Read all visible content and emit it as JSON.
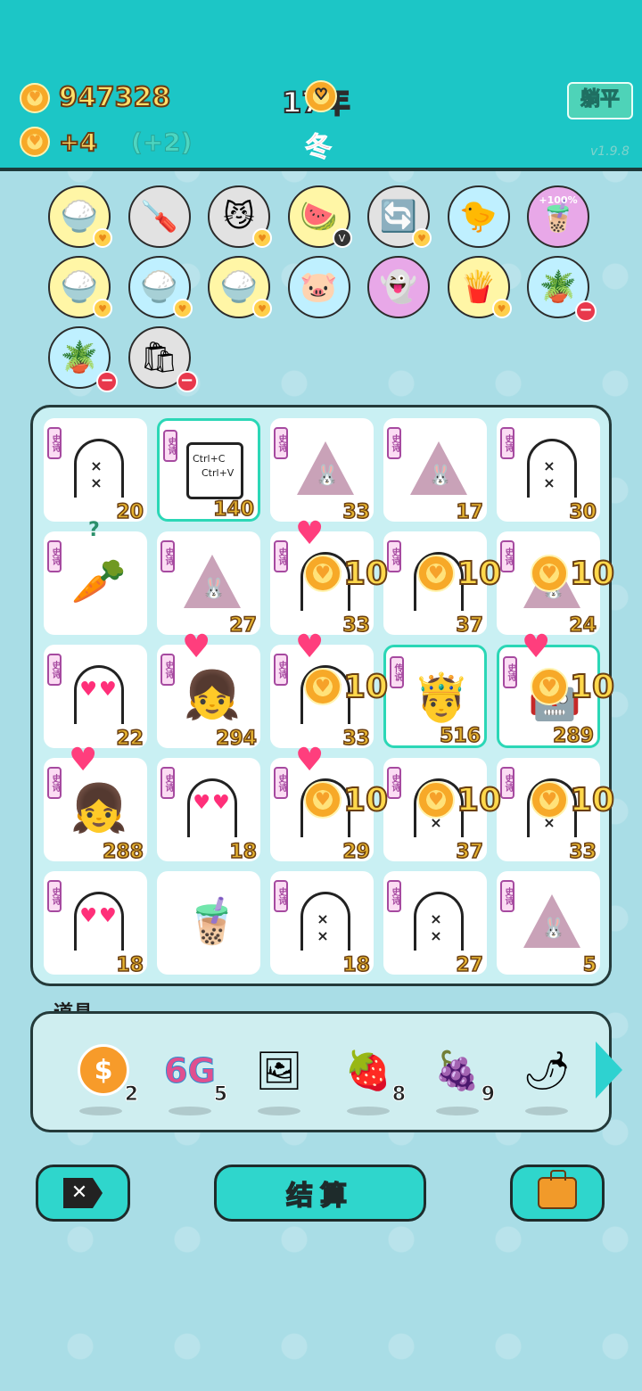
{
  "header": {
    "money": "947328",
    "income": "+4",
    "income_bonus": "(+2)",
    "year": "17年",
    "season": "冬",
    "flat_button": "躺平",
    "version": "v1.9.8"
  },
  "upgrades": [
    {
      "name": "rice-bowl",
      "color": "yellow",
      "glyph": "🍚",
      "marker": "coin"
    },
    {
      "name": "screwdriver",
      "color": "grey",
      "glyph": "🪛",
      "marker": ""
    },
    {
      "name": "glasses-cats",
      "color": "grey",
      "glyph": "😼",
      "marker": "coin"
    },
    {
      "name": "fruit-basket",
      "color": "yellow",
      "glyph": "🍉",
      "marker": "v"
    },
    {
      "name": "refresh",
      "color": "grey",
      "glyph": "🔄",
      "marker": "coin"
    },
    {
      "name": "chick",
      "color": "blue",
      "glyph": "🐤",
      "marker": ""
    },
    {
      "name": "milk-tea-plus",
      "color": "pink",
      "glyph": "🧋",
      "marker": "+100%"
    },
    {
      "name": "rice-bowl-2",
      "color": "yellow",
      "glyph": "🍚",
      "marker": "coin"
    },
    {
      "name": "rice-bowl-3",
      "color": "blue",
      "glyph": "🍚",
      "marker": "coin"
    },
    {
      "name": "rice-bowl-4",
      "color": "yellow",
      "glyph": "🍚",
      "marker": "coin"
    },
    {
      "name": "piggy-bank",
      "color": "blue",
      "glyph": "🐷",
      "marker": ""
    },
    {
      "name": "ghost-card",
      "color": "pink",
      "glyph": "👻",
      "marker": ""
    },
    {
      "name": "fries",
      "color": "yellow",
      "glyph": "🍟",
      "marker": "coin"
    },
    {
      "name": "potted-flower",
      "color": "blue",
      "glyph": "🪴",
      "marker": "minus"
    },
    {
      "name": "potted-flower-2",
      "color": "blue",
      "glyph": "🪴",
      "marker": "minus"
    },
    {
      "name": "seed-bag",
      "color": "grey",
      "glyph": "🛍",
      "marker": "minus"
    }
  ],
  "board": {
    "tag_label": "史诗",
    "tag_label_legend": "传说",
    "cells": [
      {
        "kind": "ghost",
        "eyes": "× ×",
        "value": "20",
        "tag": "史诗"
      },
      {
        "kind": "ctrl",
        "value": "140",
        "tag": "史诗",
        "selected": true,
        "line1": "Ctrl+C",
        "line2": "Ctrl+V"
      },
      {
        "kind": "bunny",
        "value": "33",
        "tag": "史诗"
      },
      {
        "kind": "bunny",
        "value": "17",
        "tag": "史诗"
      },
      {
        "kind": "ghost",
        "eyes": "× ×",
        "value": "30",
        "tag": "史诗"
      },
      {
        "kind": "carrot",
        "value": "",
        "tag": "史诗",
        "extra": "?"
      },
      {
        "kind": "bunny",
        "value": "27",
        "tag": "史诗"
      },
      {
        "kind": "ghost-love",
        "value": "33",
        "tag": "史诗",
        "bonus": "10",
        "heart": true
      },
      {
        "kind": "ghost",
        "eyes": "",
        "value": "37",
        "tag": "史诗",
        "bonus": "10"
      },
      {
        "kind": "bunny",
        "value": "24",
        "tag": "史诗",
        "bonus": "10"
      },
      {
        "kind": "ghost-love",
        "value": "22",
        "tag": "史诗"
      },
      {
        "kind": "girl",
        "value": "294",
        "tag": "史诗",
        "heart": true
      },
      {
        "kind": "ghost-love",
        "value": "33",
        "tag": "史诗",
        "bonus": "10",
        "heart": true
      },
      {
        "kind": "king",
        "value": "516",
        "tag": "传说",
        "selected": true
      },
      {
        "kind": "robot",
        "value": "289",
        "tag": "史诗",
        "selected": true,
        "bonus": "10",
        "heart": true
      },
      {
        "kind": "girl",
        "value": "288",
        "tag": "史诗",
        "heart": true
      },
      {
        "kind": "ghost-love",
        "value": "18",
        "tag": "史诗"
      },
      {
        "kind": "ghost-love",
        "value": "29",
        "tag": "史诗",
        "bonus": "10",
        "heart": true
      },
      {
        "kind": "ghost",
        "eyes": "× ×",
        "value": "37",
        "tag": "史诗",
        "bonus": "10"
      },
      {
        "kind": "ghost",
        "eyes": "× ×",
        "value": "33",
        "tag": "史诗",
        "bonus": "10"
      },
      {
        "kind": "ghost-love",
        "value": "18",
        "tag": "史诗"
      },
      {
        "kind": "milktea",
        "value": "",
        "tag": ""
      },
      {
        "kind": "ghost",
        "eyes": "× ×",
        "value": "18",
        "tag": "史诗"
      },
      {
        "kind": "ghost",
        "eyes": "× ×",
        "value": "27",
        "tag": "史诗"
      },
      {
        "kind": "bunny",
        "value": "5",
        "tag": "史诗"
      }
    ]
  },
  "items_panel": {
    "label": "道具",
    "items": [
      {
        "name": "coin-dollar",
        "glyph": "$",
        "count": "2"
      },
      {
        "name": "6g",
        "glyph": "6G",
        "count": "5"
      },
      {
        "name": "portrait",
        "glyph": "🖼",
        "count": ""
      },
      {
        "name": "strawberry",
        "glyph": "🍓",
        "count": "8"
      },
      {
        "name": "bayberry",
        "glyph": "🍇",
        "count": "9"
      },
      {
        "name": "chili",
        "glyph": "🌶",
        "count": ""
      }
    ]
  },
  "buttons": {
    "settle": "结算"
  }
}
